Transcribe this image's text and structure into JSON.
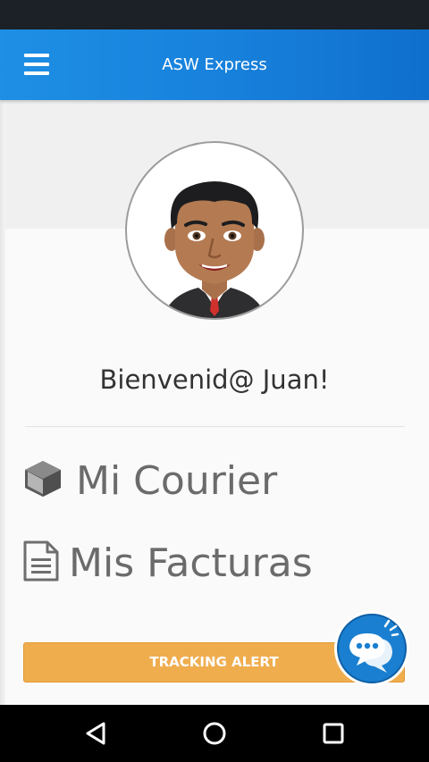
{
  "app_bar": {
    "title": "ASW Express",
    "menu_icon": "hamburger-menu-icon"
  },
  "profile": {
    "avatar_icon": "user-avatar-bitmoji",
    "welcome_text": "Bienvenid@ Juan!"
  },
  "menu": {
    "items": [
      {
        "label": "Mi Courier",
        "icon": "package-box-icon"
      },
      {
        "label": "Mis Facturas",
        "icon": "document-icon"
      }
    ]
  },
  "tracking": {
    "button_label": "TRACKING ALERT"
  },
  "chat": {
    "icon": "chat-bubbles-icon"
  },
  "system_nav": {
    "back_icon": "back-triangle-icon",
    "home_icon": "home-circle-icon",
    "recents_icon": "recents-square-icon"
  },
  "colors": {
    "app_bar_start": "#1e8fe4",
    "app_bar_end": "#0f6fcc",
    "tracking_button": "#f0ad4e",
    "chat_fab": "#1a7fd0"
  }
}
